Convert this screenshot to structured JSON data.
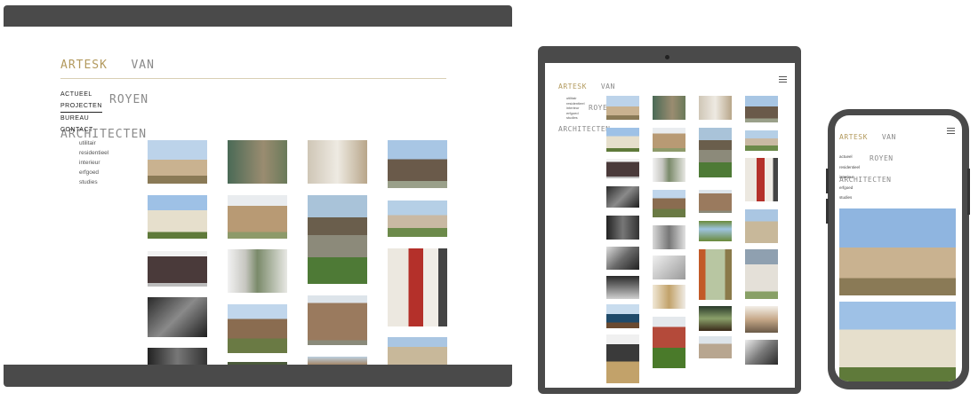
{
  "brand": {
    "line1_a": "ARTESK",
    "line1_b": "VAN",
    "line2": "ROYEN",
    "line3": "ARCHITECTEN",
    "accent_color": "#b39a5e"
  },
  "nav": {
    "main": [
      "ACTUEEL",
      "PROJECTEN",
      "BUREAU",
      "CONTACT"
    ],
    "active": "PROJECTEN",
    "sub": [
      "utilitair",
      "residentieel",
      "interieur",
      "erfgoed",
      "studies"
    ],
    "mobile_sub": [
      "actueel",
      "residentieel",
      "interieur",
      "erfgoed",
      "studies"
    ]
  },
  "icons": {
    "menu": "hamburger-menu-icon"
  },
  "devices": [
    "desktop",
    "tablet",
    "phone"
  ]
}
